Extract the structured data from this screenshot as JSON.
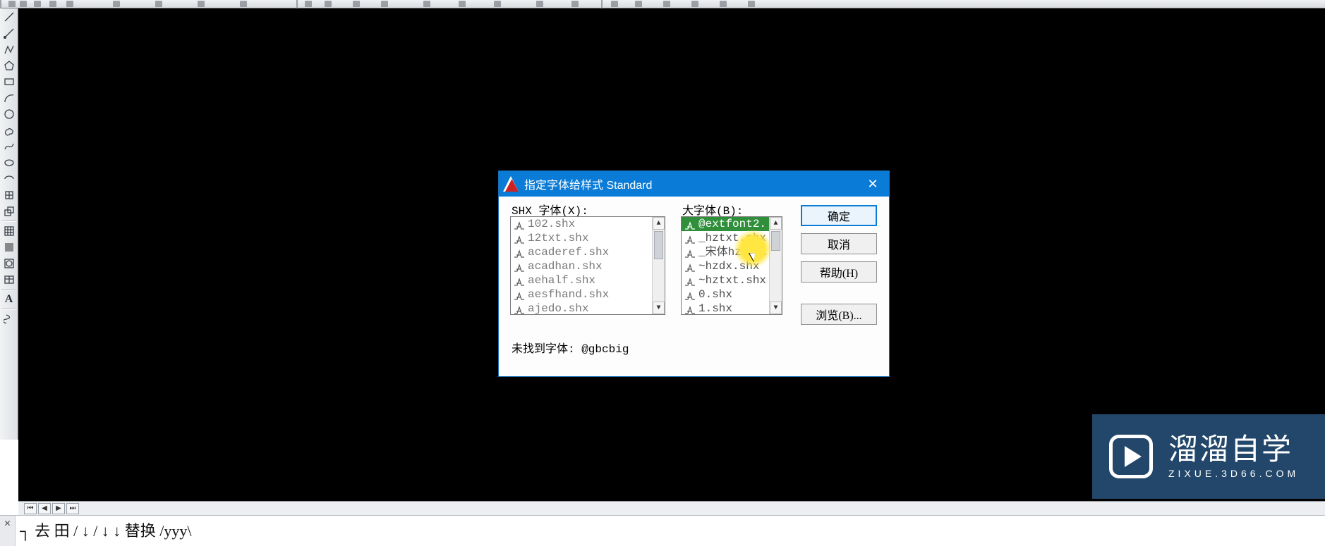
{
  "dialog": {
    "title": "指定字体给样式 Standard",
    "shx_label": "SHX 字体(X):",
    "big_label": "大字体(B):",
    "not_found": "未找到字体: @gbcbig",
    "shx_fonts": [
      "102.shx",
      "12txt.shx",
      "acaderef.shx",
      "acadhan.shx",
      "aehalf.shx",
      "aesfhand.shx",
      "ajedo.shx"
    ],
    "big_fonts": [
      "@extfont2.",
      "_hztxt.shx",
      "_宋体hztxt.",
      "~hzdx.shx",
      "~hztxt.shx",
      "0.shx",
      "1.shx"
    ],
    "big_selected_index": 0,
    "buttons": {
      "ok": "确定",
      "cancel": "取消",
      "help": "帮助(H)",
      "browse": "浏览(B)..."
    }
  },
  "watermark": {
    "brand": "溜溜自学",
    "url": "ZIXUE.3D66.COM"
  },
  "command_line": "┐ 去 田   /   ↓   /   ↓   ↓   替换   /yyy\\"
}
